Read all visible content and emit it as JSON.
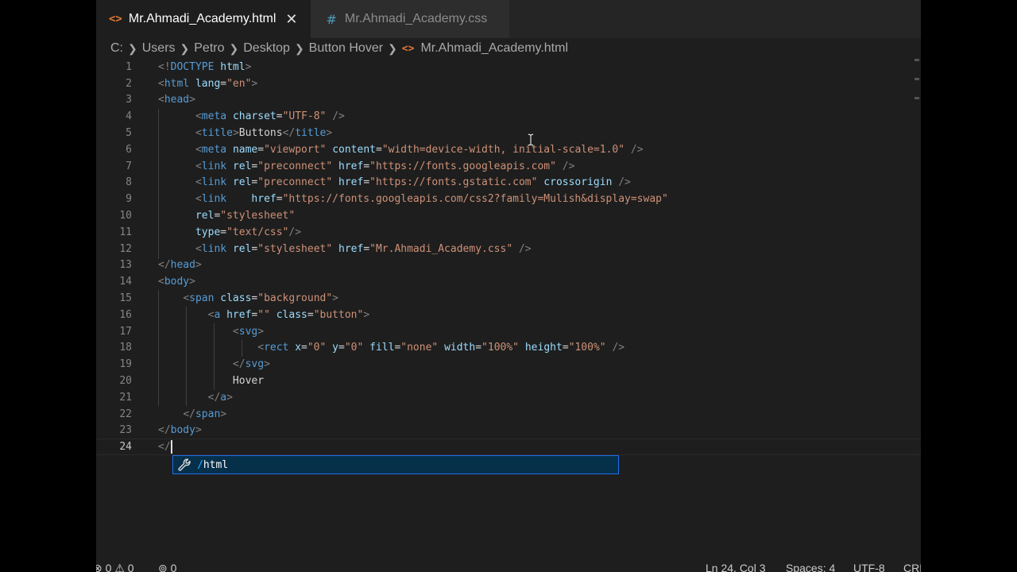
{
  "tabs": [
    {
      "icon": "html-file-icon",
      "label": "Mr.Ahmadi_Academy.html",
      "active": true
    },
    {
      "icon": "css-file-icon",
      "label": "Mr.Ahmadi_Academy.css",
      "active": false
    }
  ],
  "breadcrumb": [
    "C:",
    "Users",
    "Petro",
    "Desktop",
    "Button Hover",
    "Mr.Ahmadi_Academy.html"
  ],
  "code_lines": [
    {
      "n": "1",
      "segments": [
        [
          "p",
          "<!"
        ],
        [
          "t",
          "DOCTYPE"
        ],
        [
          "x",
          " "
        ],
        [
          "a",
          "html"
        ],
        [
          "p",
          ">"
        ]
      ]
    },
    {
      "n": "2",
      "segments": [
        [
          "p",
          "<"
        ],
        [
          "t",
          "html"
        ],
        [
          "x",
          " "
        ],
        [
          "a",
          "lang"
        ],
        [
          "x",
          "="
        ],
        [
          "s",
          "\"en\""
        ],
        [
          "p",
          ">"
        ]
      ]
    },
    {
      "n": "3",
      "segments": [
        [
          "p",
          "<"
        ],
        [
          "t",
          "head"
        ],
        [
          "p",
          ">"
        ]
      ]
    },
    {
      "n": "4",
      "segments": [
        [
          "x",
          "      "
        ],
        [
          "p",
          "<"
        ],
        [
          "t",
          "meta"
        ],
        [
          "x",
          " "
        ],
        [
          "a",
          "charset"
        ],
        [
          "x",
          "="
        ],
        [
          "s",
          "\"UTF-8\""
        ],
        [
          "x",
          " "
        ],
        [
          "p",
          "/>"
        ]
      ]
    },
    {
      "n": "5",
      "segments": [
        [
          "x",
          "      "
        ],
        [
          "p",
          "<"
        ],
        [
          "t",
          "title"
        ],
        [
          "p",
          ">"
        ],
        [
          "x",
          "Buttons"
        ],
        [
          "p",
          "</"
        ],
        [
          "t",
          "title"
        ],
        [
          "p",
          ">"
        ]
      ]
    },
    {
      "n": "6",
      "segments": [
        [
          "x",
          "      "
        ],
        [
          "p",
          "<"
        ],
        [
          "t",
          "meta"
        ],
        [
          "x",
          " "
        ],
        [
          "a",
          "name"
        ],
        [
          "x",
          "="
        ],
        [
          "s",
          "\"viewport\""
        ],
        [
          "x",
          " "
        ],
        [
          "a",
          "content"
        ],
        [
          "x",
          "="
        ],
        [
          "s",
          "\"width=device-width, initial-scale=1.0\""
        ],
        [
          "x",
          " "
        ],
        [
          "p",
          "/>"
        ]
      ]
    },
    {
      "n": "7",
      "segments": [
        [
          "x",
          "      "
        ],
        [
          "p",
          "<"
        ],
        [
          "t",
          "link"
        ],
        [
          "x",
          " "
        ],
        [
          "a",
          "rel"
        ],
        [
          "x",
          "="
        ],
        [
          "s",
          "\"preconnect\""
        ],
        [
          "x",
          " "
        ],
        [
          "a",
          "href"
        ],
        [
          "x",
          "="
        ],
        [
          "s",
          "\"https://fonts.googleapis.com\""
        ],
        [
          "x",
          " "
        ],
        [
          "p",
          "/>"
        ]
      ]
    },
    {
      "n": "8",
      "segments": [
        [
          "x",
          "      "
        ],
        [
          "p",
          "<"
        ],
        [
          "t",
          "link"
        ],
        [
          "x",
          " "
        ],
        [
          "a",
          "rel"
        ],
        [
          "x",
          "="
        ],
        [
          "s",
          "\"preconnect\""
        ],
        [
          "x",
          " "
        ],
        [
          "a",
          "href"
        ],
        [
          "x",
          "="
        ],
        [
          "s",
          "\"https://fonts.gstatic.com\""
        ],
        [
          "x",
          " "
        ],
        [
          "a",
          "crossorigin"
        ],
        [
          "x",
          " "
        ],
        [
          "p",
          "/>"
        ]
      ]
    },
    {
      "n": "9",
      "segments": [
        [
          "x",
          "      "
        ],
        [
          "p",
          "<"
        ],
        [
          "t",
          "link"
        ],
        [
          "x",
          "    "
        ],
        [
          "a",
          "href"
        ],
        [
          "x",
          "="
        ],
        [
          "s",
          "\"https://fonts.googleapis.com/css2?family=Mulish&display=swap\""
        ]
      ]
    },
    {
      "n": "10",
      "segments": [
        [
          "x",
          "      "
        ],
        [
          "a",
          "rel"
        ],
        [
          "x",
          "="
        ],
        [
          "s",
          "\"stylesheet\""
        ]
      ]
    },
    {
      "n": "11",
      "segments": [
        [
          "x",
          "      "
        ],
        [
          "a",
          "type"
        ],
        [
          "x",
          "="
        ],
        [
          "s",
          "\"text/css\""
        ],
        [
          "p",
          "/>"
        ]
      ]
    },
    {
      "n": "12",
      "segments": [
        [
          "x",
          "      "
        ],
        [
          "p",
          "<"
        ],
        [
          "t",
          "link"
        ],
        [
          "x",
          " "
        ],
        [
          "a",
          "rel"
        ],
        [
          "x",
          "="
        ],
        [
          "s",
          "\"stylesheet\""
        ],
        [
          "x",
          " "
        ],
        [
          "a",
          "href"
        ],
        [
          "x",
          "="
        ],
        [
          "s",
          "\"Mr.Ahmadi_Academy.css\""
        ],
        [
          "x",
          " "
        ],
        [
          "p",
          "/>"
        ]
      ]
    },
    {
      "n": "13",
      "segments": [
        [
          "p",
          "</"
        ],
        [
          "t",
          "head"
        ],
        [
          "p",
          ">"
        ]
      ]
    },
    {
      "n": "14",
      "segments": [
        [
          "p",
          "<"
        ],
        [
          "t",
          "body"
        ],
        [
          "p",
          ">"
        ]
      ]
    },
    {
      "n": "15",
      "segments": [
        [
          "x",
          "    "
        ],
        [
          "p",
          "<"
        ],
        [
          "t",
          "span"
        ],
        [
          "x",
          " "
        ],
        [
          "a",
          "class"
        ],
        [
          "x",
          "="
        ],
        [
          "s",
          "\"background\""
        ],
        [
          "p",
          ">"
        ]
      ]
    },
    {
      "n": "16",
      "segments": [
        [
          "x",
          "        "
        ],
        [
          "p",
          "<"
        ],
        [
          "t",
          "a"
        ],
        [
          "x",
          " "
        ],
        [
          "a",
          "href"
        ],
        [
          "x",
          "="
        ],
        [
          "s",
          "\"\""
        ],
        [
          "x",
          " "
        ],
        [
          "a",
          "class"
        ],
        [
          "x",
          "="
        ],
        [
          "s",
          "\"button\""
        ],
        [
          "p",
          ">"
        ]
      ]
    },
    {
      "n": "17",
      "segments": [
        [
          "x",
          "            "
        ],
        [
          "p",
          "<"
        ],
        [
          "t",
          "svg"
        ],
        [
          "p",
          ">"
        ]
      ]
    },
    {
      "n": "18",
      "segments": [
        [
          "x",
          "                "
        ],
        [
          "p",
          "<"
        ],
        [
          "t",
          "rect"
        ],
        [
          "x",
          " "
        ],
        [
          "a",
          "x"
        ],
        [
          "x",
          "="
        ],
        [
          "s",
          "\"0\""
        ],
        [
          "x",
          " "
        ],
        [
          "a",
          "y"
        ],
        [
          "x",
          "="
        ],
        [
          "s",
          "\"0\""
        ],
        [
          "x",
          " "
        ],
        [
          "a",
          "fill"
        ],
        [
          "x",
          "="
        ],
        [
          "s",
          "\"none\""
        ],
        [
          "x",
          " "
        ],
        [
          "a",
          "width"
        ],
        [
          "x",
          "="
        ],
        [
          "s",
          "\"100%\""
        ],
        [
          "x",
          " "
        ],
        [
          "a",
          "height"
        ],
        [
          "x",
          "="
        ],
        [
          "s",
          "\"100%\""
        ],
        [
          "x",
          " "
        ],
        [
          "p",
          "/>"
        ]
      ]
    },
    {
      "n": "19",
      "segments": [
        [
          "x",
          "            "
        ],
        [
          "p",
          "</"
        ],
        [
          "t",
          "svg"
        ],
        [
          "p",
          ">"
        ]
      ]
    },
    {
      "n": "20",
      "segments": [
        [
          "x",
          "            Hover"
        ]
      ]
    },
    {
      "n": "21",
      "segments": [
        [
          "x",
          "        "
        ],
        [
          "p",
          "</"
        ],
        [
          "t",
          "a"
        ],
        [
          "p",
          ">"
        ]
      ]
    },
    {
      "n": "22",
      "segments": [
        [
          "x",
          "    "
        ],
        [
          "p",
          "</"
        ],
        [
          "t",
          "span"
        ],
        [
          "p",
          ">"
        ]
      ]
    },
    {
      "n": "23",
      "segments": [
        [
          "p",
          "</"
        ],
        [
          "t",
          "body"
        ],
        [
          "p",
          ">"
        ]
      ]
    },
    {
      "n": "24",
      "segments": [
        [
          "p",
          "</"
        ]
      ]
    }
  ],
  "current_line": "24",
  "suggestion": {
    "icon": "wrench-icon",
    "match": "/",
    "rest": "html"
  },
  "status": {
    "errors": "0",
    "warnings": "0",
    "ports": "0",
    "position": "Ln 24, Col 3",
    "spaces": "Spaces: 4",
    "encoding": "UTF-8",
    "eol": "CRL"
  }
}
